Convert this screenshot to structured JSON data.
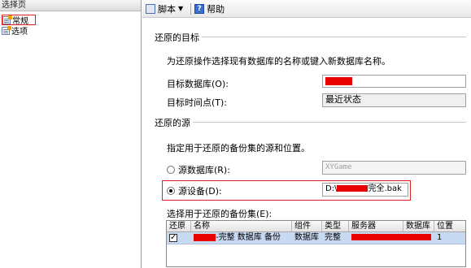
{
  "left_panel": {
    "header": "选择页",
    "items": [
      {
        "label": "常规",
        "icon": "page-icon"
      },
      {
        "label": "选项",
        "icon": "page-icon"
      }
    ]
  },
  "toolbar": {
    "script_label": "脚本",
    "help_label": "帮助"
  },
  "restore_target": {
    "section_title": "还原的目标",
    "description": "为还原操作选择现有数据库的名称或键入新数据库名称。",
    "target_db_label": "目标数据库(O):",
    "target_db_value": "",
    "target_time_label": "目标时间点(T):",
    "target_time_value": "最近状态"
  },
  "restore_source": {
    "section_title": "还原的源",
    "description": "指定用于还原的备份集的源和位置。",
    "source_db_label": "源数据库(R):",
    "source_db_value": "XYGame",
    "source_device_label": "源设备(D):",
    "source_device_prefix": "D:\\",
    "source_device_suffix": "完全.bak",
    "backup_sets_label": "选择用于还原的备份集(E):"
  },
  "backup_grid": {
    "columns": [
      "还原",
      "名称",
      "组件",
      "类型",
      "服务器",
      "数据库",
      "位置"
    ],
    "rows": [
      {
        "restore": true,
        "name_suffix": "-完整 数据库 备份",
        "component": "数据库",
        "type": "完整",
        "server": "",
        "database": "",
        "position": "1"
      }
    ]
  },
  "colors": {
    "redaction": "#e80000",
    "highlight": "#e02020",
    "selected_row": "#c8d9f2"
  }
}
